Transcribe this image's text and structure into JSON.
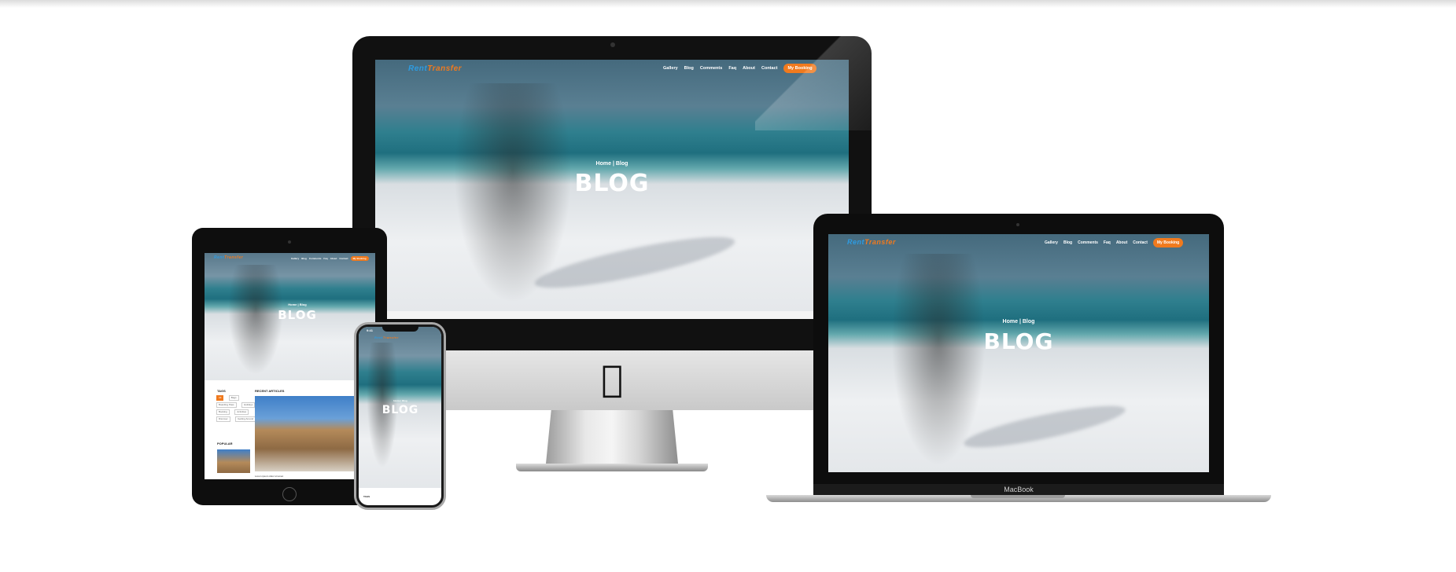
{
  "site": {
    "logo_part1": "Rent",
    "logo_part2": "Transfer",
    "nav": [
      "Gallery",
      "Blog",
      "Comments",
      "Faq",
      "About",
      "Contact"
    ],
    "booking_button": "My Booking",
    "breadcrumb_home": "Home",
    "breadcrumb_sep": "|",
    "breadcrumb_current": "Blog",
    "hero_title": "BLOG"
  },
  "macbook": {
    "label": "MacBook"
  },
  "ipad_page": {
    "tags_heading": "TAGS",
    "tags": [
      "All",
      "Bags",
      "Boarding Pass",
      "Holidays",
      "Booking",
      "Activities",
      "Discover",
      "Getting Around"
    ],
    "recent_heading": "RECENT ARTICLES",
    "popular_heading": "POPULAR",
    "article_caption": "Lorem ipsum dolor sit amet"
  },
  "iphone": {
    "status_time": "9:41",
    "tags_heading": "TAGS"
  },
  "colors": {
    "accent": "#f07a1e",
    "logo_blue": "#2e9be0",
    "device_black": "#111111"
  },
  "icons": {
    "apple_logo": "apple-logo-icon"
  }
}
